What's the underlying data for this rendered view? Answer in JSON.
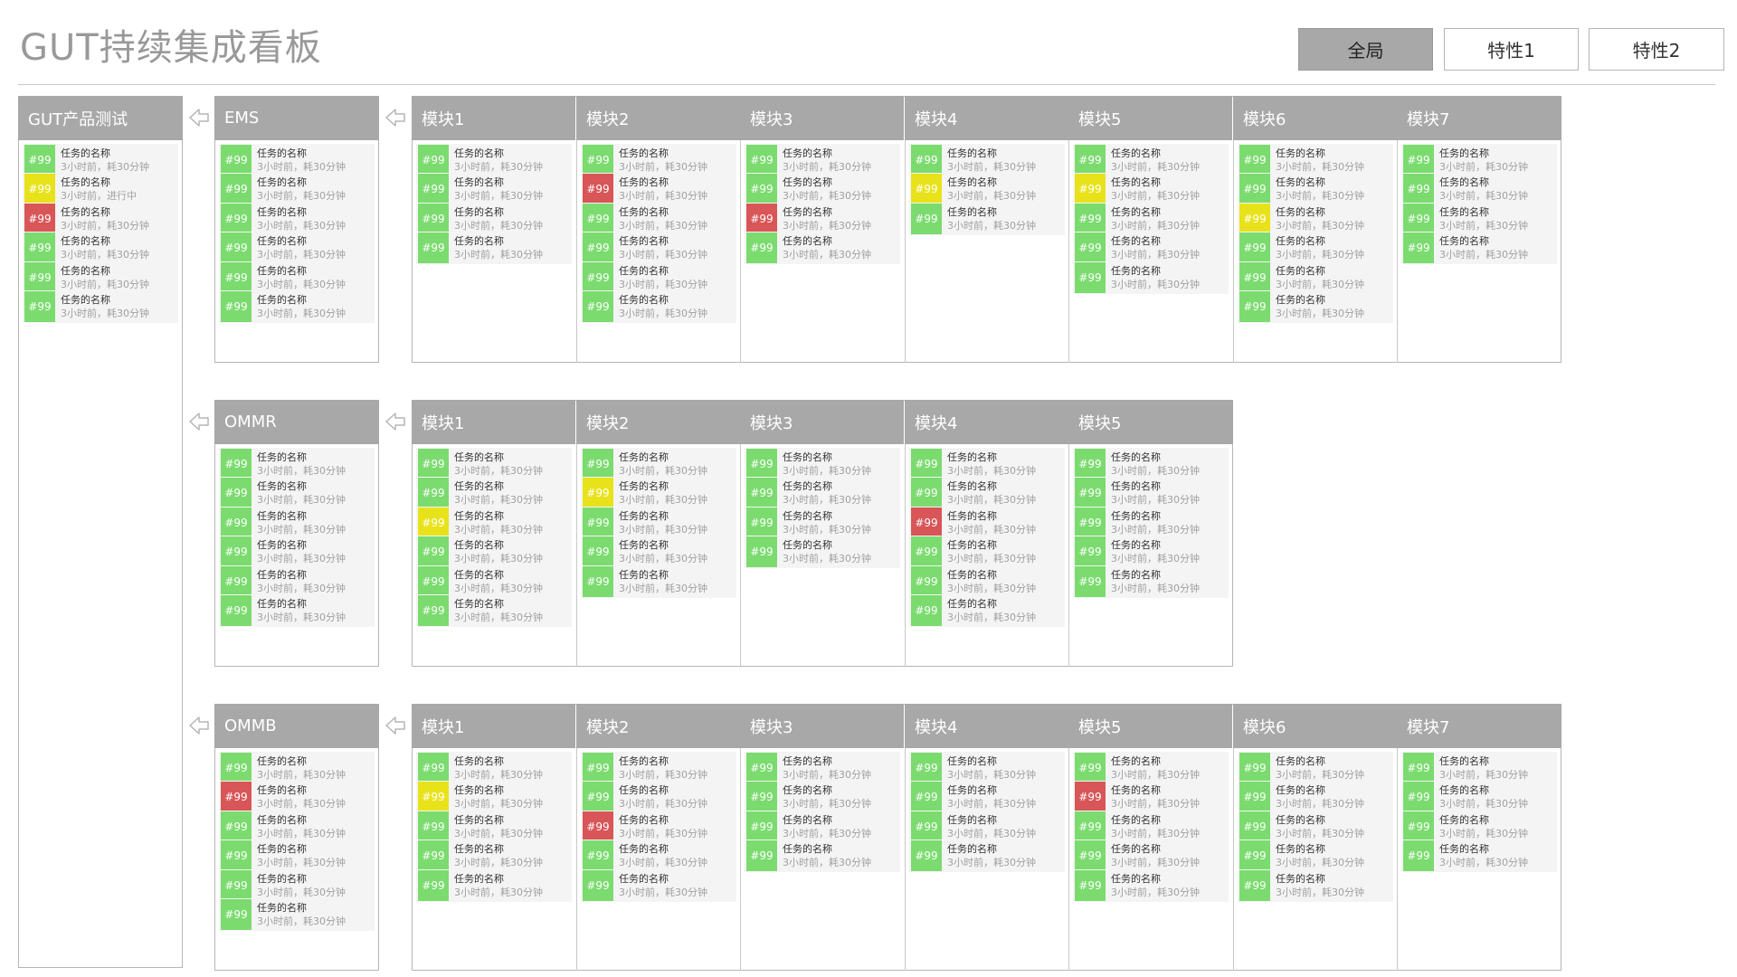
{
  "app": {
    "title": "GUT持续集成看板"
  },
  "tabs": [
    {
      "label": "全局",
      "active": true
    },
    {
      "label": "特性1",
      "active": false
    },
    {
      "label": "特性2",
      "active": false
    }
  ],
  "colors": {
    "green": "#7bdb6f",
    "yellow": "#e8e21a",
    "red": "#d85558",
    "header": "#a8a8a8"
  },
  "icons": {
    "flow_arrow": "left-arrow-icon"
  },
  "product": {
    "label": "GUT产品测试",
    "tasks": [
      {
        "num": "#99",
        "status": "green",
        "name": "任务的名称",
        "meta": "3小时前，耗30分钟"
      },
      {
        "num": "#99",
        "status": "yellow",
        "name": "任务的名称",
        "meta": "3小时前，进行中"
      },
      {
        "num": "#99",
        "status": "red",
        "name": "任务的名称",
        "meta": "3小时前，耗30分钟"
      },
      {
        "num": "#99",
        "status": "green",
        "name": "任务的名称",
        "meta": "3小时前，耗30分钟"
      },
      {
        "num": "#99",
        "status": "green",
        "name": "任务的名称",
        "meta": "3小时前，耗30分钟"
      },
      {
        "num": "#99",
        "status": "green",
        "name": "任务的名称",
        "meta": "3小时前，耗30分钟"
      }
    ]
  },
  "subsystems": [
    {
      "label": "EMS",
      "tasks": [
        "green",
        "green",
        "green",
        "green",
        "green",
        "green"
      ],
      "modules": [
        {
          "label": "模块1",
          "tasks": [
            "green",
            "green",
            "green",
            "green"
          ]
        },
        {
          "label": "模块2",
          "tasks": [
            "green",
            "red",
            "green",
            "green",
            "green",
            "green"
          ],
          "extra_tasks": [
            "green",
            "green",
            "green"
          ]
        },
        {
          "label": "模块3",
          "tasks": [
            "green",
            "green",
            "red",
            "green"
          ]
        },
        {
          "label": "模块4",
          "tasks": [
            "green",
            "yellow",
            "green"
          ]
        },
        {
          "label": "模块5",
          "tasks": [
            "green",
            "yellow",
            "green",
            "green",
            "green"
          ]
        },
        {
          "label": "模块6",
          "tasks": [
            "green",
            "green",
            "yellow",
            "green",
            "green",
            "green"
          ]
        },
        {
          "label": "模块7",
          "tasks": [
            "green",
            "green",
            "green",
            "green"
          ]
        }
      ]
    },
    {
      "label": "OMMR",
      "tasks": [
        "green",
        "green",
        "green",
        "green",
        "green",
        "green"
      ],
      "modules": [
        {
          "label": "模块1",
          "tasks": [
            "green",
            "green",
            "yellow",
            "green",
            "green",
            "green"
          ]
        },
        {
          "label": "模块2",
          "tasks": [
            "green",
            "yellow",
            "green",
            "green",
            "green"
          ]
        },
        {
          "label": "模块3",
          "tasks": [
            "green",
            "green",
            "green",
            "green"
          ]
        },
        {
          "label": "模块4",
          "tasks": [
            "green",
            "green",
            "red",
            "green",
            "green",
            "green"
          ]
        },
        {
          "label": "模块5",
          "tasks": [
            "green",
            "green",
            "green",
            "green",
            "green"
          ]
        }
      ]
    },
    {
      "label": "OMMB",
      "tasks": [
        "green",
        "red",
        "green",
        "green",
        "green",
        "green"
      ],
      "modules": [
        {
          "label": "模块1",
          "tasks": [
            "green",
            "yellow",
            "green",
            "green",
            "green"
          ]
        },
        {
          "label": "模块2",
          "tasks": [
            "green",
            "green",
            "red",
            "green",
            "green"
          ]
        },
        {
          "label": "模块3",
          "tasks": [
            "green",
            "green",
            "green",
            "green"
          ]
        },
        {
          "label": "模块4",
          "tasks": [
            "green",
            "green",
            "green",
            "green"
          ]
        },
        {
          "label": "模块5",
          "tasks": [
            "green",
            "red",
            "green",
            "green",
            "green"
          ]
        },
        {
          "label": "模块6",
          "tasks": [
            "green",
            "green",
            "green",
            "green",
            "green"
          ]
        },
        {
          "label": "模块7",
          "tasks": [
            "green",
            "green",
            "green",
            "green"
          ]
        }
      ]
    }
  ],
  "task_defaults": {
    "num": "#99",
    "name": "任务的名称",
    "meta": "3小时前，耗30分钟"
  }
}
